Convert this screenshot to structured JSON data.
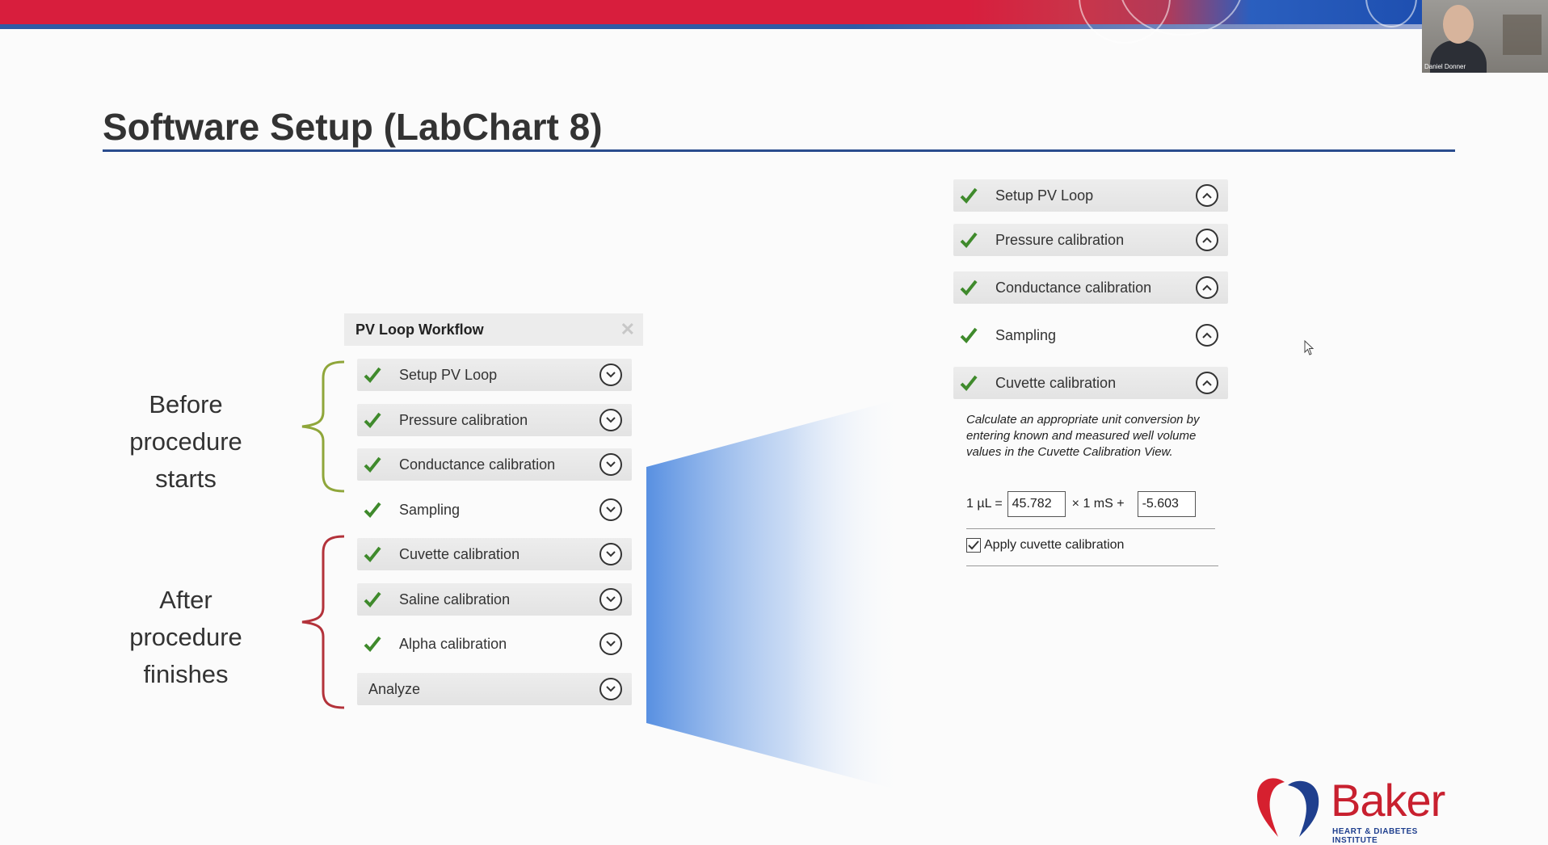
{
  "video": {
    "participant_name": "Daniel Donner"
  },
  "slide": {
    "title": "Software Setup (LabChart 8)"
  },
  "groups": {
    "before": {
      "line1": "Before procedure",
      "line2": "starts"
    },
    "after": {
      "line1": "After procedure",
      "line2": "finishes"
    }
  },
  "workflow": {
    "title": "PV Loop Workflow",
    "close_icon": "close-icon",
    "steps": [
      {
        "label": "Setup PV Loop",
        "checked": true
      },
      {
        "label": "Pressure calibration",
        "checked": true
      },
      {
        "label": "Conductance calibration",
        "checked": true
      },
      {
        "label": "Sampling",
        "checked": true
      },
      {
        "label": "Cuvette calibration",
        "checked": true
      },
      {
        "label": "Saline calibration",
        "checked": true
      },
      {
        "label": "Alpha calibration",
        "checked": true
      },
      {
        "label": "Analyze",
        "checked": false
      }
    ]
  },
  "detail": {
    "steps": [
      {
        "label": "Setup PV Loop"
      },
      {
        "label": "Pressure calibration"
      },
      {
        "label": "Conductance calibration"
      },
      {
        "label": "Sampling"
      },
      {
        "label": "Cuvette calibration"
      }
    ],
    "description": "Calculate an appropriate unit conversion by entering known and measured well volume values in the Cuvette Calibration View.",
    "formula": {
      "lhs": "1 µL =",
      "value1": "45.782",
      "mid": "× 1 mS +",
      "value2": "-5.603"
    },
    "apply_label": "Apply cuvette calibration",
    "apply_checked": true
  },
  "logo": {
    "word": "Baker",
    "subtitle": "HEART & DIABETES INSTITUTE"
  },
  "colors": {
    "check_green": "#3f8a2c",
    "brace_green": "#8fa63a",
    "brace_red": "#b3323a",
    "accent_blue": "#2a4c8e"
  }
}
